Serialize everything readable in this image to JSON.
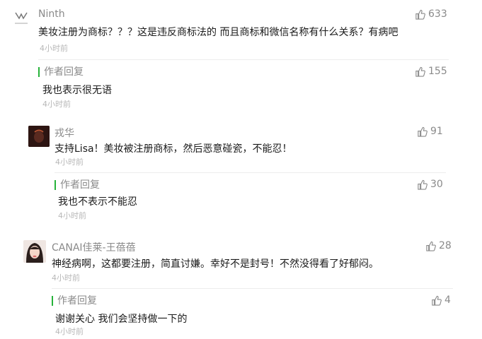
{
  "comments": [
    {
      "name": "Ninth",
      "text": "美妆注册为商标？？？这是违反商标法的 而且商标和微信名称有什么关系？有病吧",
      "time": "4小时前",
      "likes": "633",
      "avatar_icon": "ninth-logo-avatar",
      "reply": {
        "label": "作者回复",
        "text": "我也表示很无语",
        "time": "4小时前",
        "likes": "155"
      }
    },
    {
      "name": "戎华",
      "text": "支持Lisa！美妆被注册商标，然后恶意碰瓷，不能忍！",
      "time": "4小时前",
      "likes": "91",
      "avatar_icon": "dark-photo-avatar",
      "reply": {
        "label": "作者回复",
        "text": "我也不表示不能忍",
        "time": "4小时前",
        "likes": "30"
      }
    },
    {
      "name": "CANAI佳莱-王蓓蓓",
      "text": "神经病啊，这都要注册，简直讨嫌。幸好不是封号！不然没得看了好郁闷。",
      "time": "4小时前",
      "likes": "28",
      "avatar_icon": "woman-photo-avatar",
      "reply": {
        "label": "作者回复",
        "text": "谢谢关心 我们会坚持做一下的",
        "time": "4小时前",
        "likes": "4"
      }
    }
  ],
  "colors": {
    "reply_accent": "#26b33a",
    "meta": "#8a8a8a",
    "time": "#b8b8b8"
  }
}
